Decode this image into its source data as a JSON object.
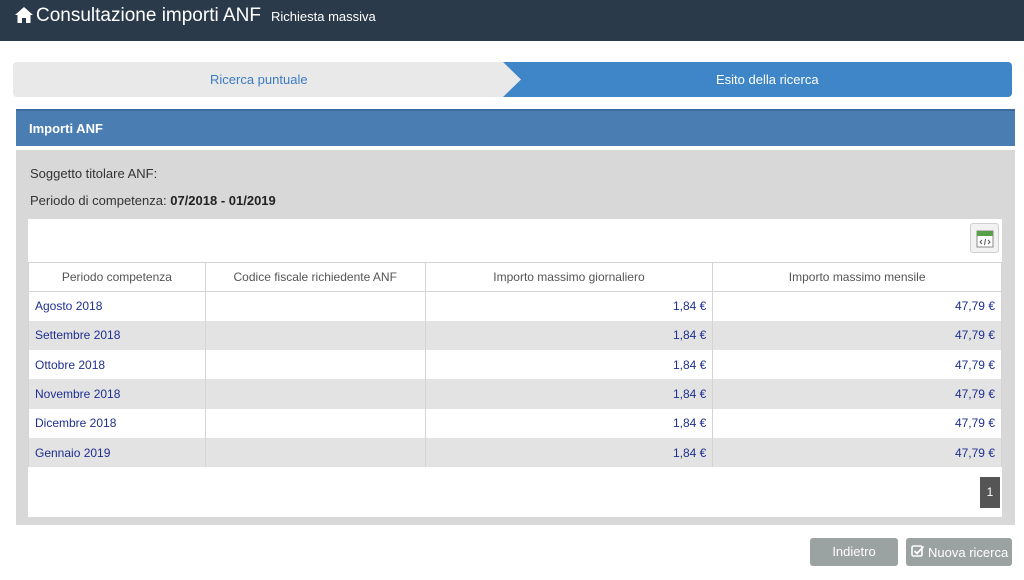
{
  "header": {
    "app_title": "Consultazione importi ANF",
    "nav_link": "Richiesta massiva",
    "icon": "home-icon"
  },
  "wizard": {
    "steps": [
      {
        "label": "Ricerca puntuale",
        "active": false
      },
      {
        "label": "Esito della ricerca",
        "active": true
      }
    ],
    "active_color": "#3f86c9"
  },
  "panel": {
    "title": "Importi ANF",
    "subject_label": "Soggetto titolare ANF:",
    "subject_value": "",
    "period_label": "Periodo di competenza:",
    "period_value": "07/2018 - 01/2019"
  },
  "table": {
    "export_icon": "export-spreadsheet-icon",
    "columns": [
      "Periodo competenza",
      "Codice fiscale richiedente ANF",
      "Importo massimo giornaliero",
      "Importo massimo mensile"
    ],
    "rows": [
      {
        "periodo": "Agosto 2018",
        "codice": "",
        "giornaliero": "1,84 €",
        "mensile": "47,79 €"
      },
      {
        "periodo": "Settembre 2018",
        "codice": "",
        "giornaliero": "1,84 €",
        "mensile": "47,79 €"
      },
      {
        "periodo": "Ottobre 2018",
        "codice": "",
        "giornaliero": "1,84 €",
        "mensile": "47,79 €"
      },
      {
        "periodo": "Novembre 2018",
        "codice": "",
        "giornaliero": "1,84 €",
        "mensile": "47,79 €"
      },
      {
        "periodo": "Dicembre 2018",
        "codice": "",
        "giornaliero": "1,84 €",
        "mensile": "47,79 €"
      },
      {
        "periodo": "Gennaio 2019",
        "codice": "",
        "giornaliero": "1,84 €",
        "mensile": "47,79 €"
      }
    ],
    "pagination": {
      "current_page": "1"
    }
  },
  "actions": {
    "back_label": "Indietro",
    "new_search_label": "Nuova ricerca",
    "new_search_icon": "checkbox-icon"
  }
}
